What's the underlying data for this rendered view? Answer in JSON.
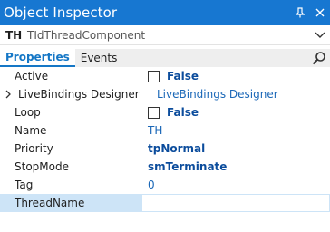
{
  "window": {
    "title": "Object Inspector",
    "pin_icon": "pin-icon",
    "close_icon": "close-icon",
    "accent": "#1777d1"
  },
  "component": {
    "name": "TH",
    "type": "TIdThreadComponent"
  },
  "tabs": [
    {
      "label": "Properties",
      "active": true
    },
    {
      "label": "Events",
      "active": false
    }
  ],
  "properties": [
    {
      "name": "Active",
      "value": "False",
      "checkbox": true
    },
    {
      "name": "LiveBindings Designer",
      "value": "LiveBindings Designer",
      "expandable": true
    },
    {
      "name": "Loop",
      "value": "False",
      "checkbox": true
    },
    {
      "name": "Name",
      "value": "TH"
    },
    {
      "name": "Priority",
      "value": "tpNormal"
    },
    {
      "name": "StopMode",
      "value": "smTerminate"
    },
    {
      "name": "Tag",
      "value": "0"
    },
    {
      "name": "ThreadName",
      "value": "",
      "selected": true
    }
  ]
}
